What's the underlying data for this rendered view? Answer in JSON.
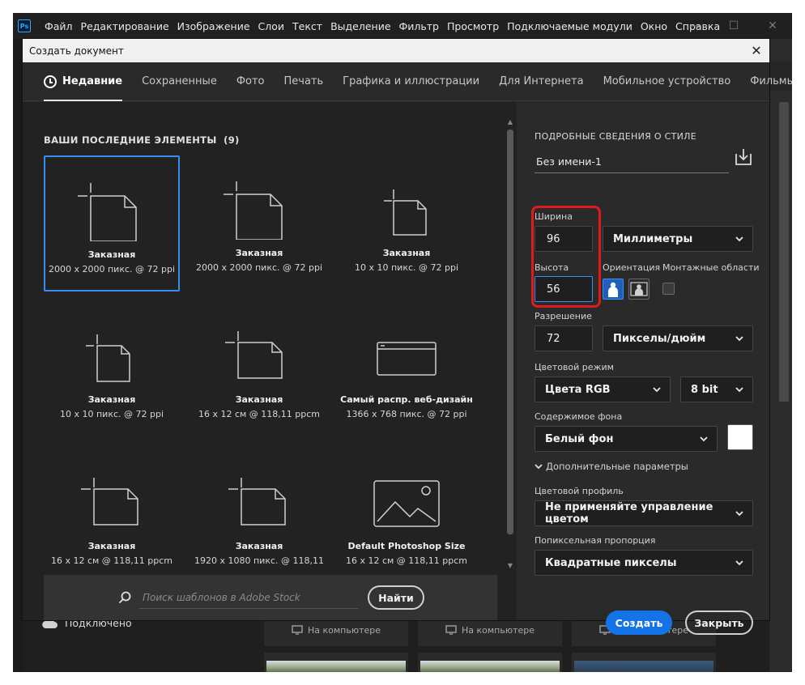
{
  "app": {
    "logo": "Ps"
  },
  "menu": [
    "Файл",
    "Редактирование",
    "Изображение",
    "Слои",
    "Текст",
    "Выделение",
    "Фильтр",
    "Просмотр",
    "Подключаемые модули",
    "Окно",
    "Справка"
  ],
  "window_controls": {
    "minimize": "—",
    "maximize": "☐",
    "close": "✕"
  },
  "dialog": {
    "title": "Создать документ",
    "close_glyph": "✕",
    "tabs": [
      "Недавние",
      "Сохраненные",
      "Фото",
      "Печать",
      "Графика и иллюстрации",
      "Для Интернета",
      "Мобильное устройство",
      "Фильмы и видео"
    ],
    "recent": {
      "heading": "ВАШИ ПОСЛЕДНИЕ ЭЛЕМЕНТЫ",
      "count": "(9)",
      "items": [
        {
          "name": "Заказная",
          "dims": "2000 x 2000 пикс. @ 72 ppi",
          "icon": "document-icon"
        },
        {
          "name": "Заказная",
          "dims": "2000 x 2000 пикс. @ 72 ppi",
          "icon": "document-icon"
        },
        {
          "name": "Заказная",
          "dims": "10 x 10 пикс. @ 72 ppi",
          "icon": "document-icon"
        },
        {
          "name": "Заказная",
          "dims": "10 x 10 пикс. @ 72 ppi",
          "icon": "document-icon"
        },
        {
          "name": "Заказная",
          "dims": "16 x 12 см @ 118,11 ppcm",
          "icon": "document-icon"
        },
        {
          "name": "Самый распр. веб-дизайн",
          "dims": "1366 x 768 пикс. @ 72 ppi",
          "icon": "browser-window-icon"
        },
        {
          "name": "Заказная",
          "dims": "16 x 12 см @ 118,11 ppcm",
          "icon": "document-icon"
        },
        {
          "name": "Заказная",
          "dims": "1920 x 1080 пикс. @ 118,11",
          "icon": "document-icon"
        },
        {
          "name": "Default Photoshop Size",
          "dims": "16 x 12 см @ 118,11 ppcm",
          "icon": "image-icon"
        }
      ]
    },
    "search": {
      "placeholder": "Поиск шаблонов в Adobe Stock",
      "button": "Найти"
    },
    "details": {
      "heading": "ПОДРОБНЫЕ СВЕДЕНИЯ О СТИЛЕ",
      "doc_name": "Без имени-1",
      "width_label": "Ширина",
      "width_value": "96",
      "width_unit": "Миллиметры",
      "height_label": "Высота",
      "height_value": "56",
      "orientation_label": "Ориентация",
      "artboards_label": "Монтажные области",
      "resolution_label": "Разрешение",
      "resolution_value": "72",
      "resolution_unit": "Пикселы/дюйм",
      "color_mode_label": "Цветовой режим",
      "color_mode": "Цвета RGB",
      "bit_depth": "8 bit",
      "background_label": "Содержимое фона",
      "background": "Белый фон",
      "background_swatch": "#ffffff",
      "advanced_label": "Дополнительные параметры",
      "color_profile_label": "Цветовой профиль",
      "color_profile": "Не применяйте управление цветом",
      "pixel_aspect_label": "Попиксельная пропорция",
      "pixel_aspect": "Квадратные пикселы"
    },
    "buttons": {
      "create": "Создать",
      "close": "Закрыть"
    }
  },
  "background": {
    "cloud_status": "Подключено",
    "cards": [
      "На компьютере",
      "На компьютере",
      "На компьютере"
    ]
  },
  "colors": {
    "accent": "#1473e6",
    "highlight": "#e01b1b",
    "selection": "#378ef0"
  }
}
